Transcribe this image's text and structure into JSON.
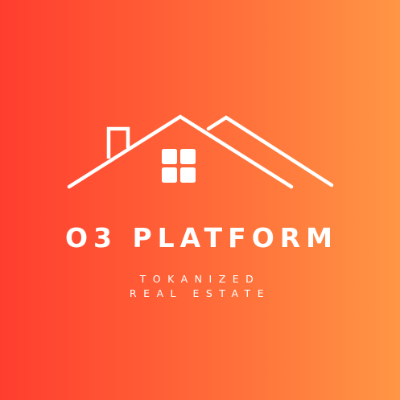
{
  "logo": {
    "icon": "house-roof-icon",
    "title": "O3 PLATFORM",
    "tagline_line1": "TOKANIZED",
    "tagline_line2": "REAL ESTATE"
  },
  "colors": {
    "gradient_start": "#ff3d2f",
    "gradient_end": "#ff9645",
    "foreground": "#ffffff"
  }
}
